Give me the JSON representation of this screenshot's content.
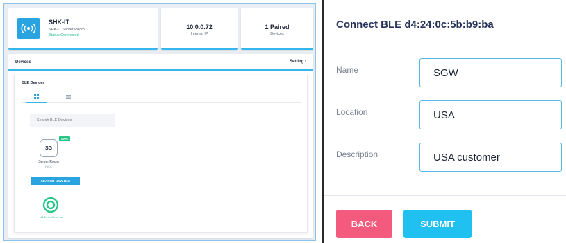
{
  "left_app": {
    "device": {
      "name": "SHK-IT",
      "subtitle": "SHK-IT Server Room",
      "status": "Status Connected"
    },
    "stats": [
      {
        "value": "10.0.0.72",
        "label": "Internal IP"
      },
      {
        "value": "1 Paired",
        "label": "Devices"
      }
    ],
    "devices_section": {
      "title": "Devices",
      "setting_label": "Setting"
    },
    "ble": {
      "title": "BLE Devices",
      "search_placeholder": "Search BLE Devices",
      "tile_icon_text": "SG",
      "tile_badge": "100%",
      "tile_name": "Server Room",
      "tile_sub": "HK01",
      "search_new_label": "SEARCH NEW BLE",
      "mac_label": "d4:24:0c:5b:b9:ba"
    }
  },
  "dialog": {
    "title": "Connect BLE d4:24:0c:5b:b9:ba",
    "fields": {
      "name": {
        "label": "Name",
        "value": "SGW"
      },
      "location": {
        "label": "Location",
        "value": "USA"
      },
      "description": {
        "label": "Description",
        "value": "USA customer"
      }
    },
    "buttons": {
      "back": "BACK",
      "submit": "SUBMIT"
    }
  },
  "colors": {
    "accent": "#37b6ee",
    "back_button": "#f35a7e",
    "submit_button": "#20c0f0",
    "status_green": "#22c08a"
  }
}
